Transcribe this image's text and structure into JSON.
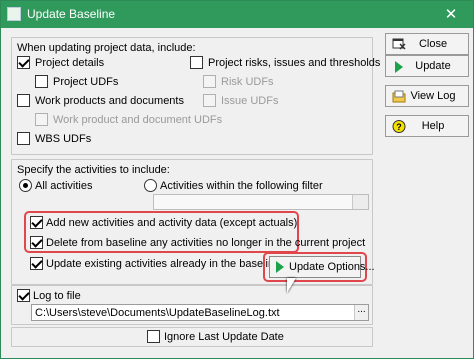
{
  "window": {
    "title": "Update Baseline",
    "close_glyph": "✕"
  },
  "section1": {
    "header": "When updating project data, include:",
    "project_details": {
      "label": "Project details",
      "checked": true
    },
    "project_udfs": {
      "label": "Project UDFs",
      "checked": false
    },
    "work_products": {
      "label": "Work products and documents",
      "checked": false
    },
    "work_product_udfs": {
      "label": "Work product and document UDFs",
      "checked": false,
      "disabled": true
    },
    "wbs_udfs": {
      "label": "WBS UDFs",
      "checked": false
    },
    "risks": {
      "label": "Project risks, issues and thresholds",
      "checked": false
    },
    "risk_udfs": {
      "label": "Risk UDFs",
      "checked": false,
      "disabled": true
    },
    "issue_udfs": {
      "label": "Issue UDFs",
      "checked": false,
      "disabled": true
    }
  },
  "section2": {
    "header": "Specify the activities to include:",
    "all_activities": {
      "label": "All activities",
      "selected": true
    },
    "filter_activities": {
      "label": "Activities within the following filter",
      "selected": false
    },
    "filter_value": "",
    "browse_glyph": "...",
    "add_new": {
      "label": "Add new activities and activity data (except actuals)",
      "checked": true
    },
    "delete_from_baseline": {
      "label": "Delete from baseline any activities no longer in the current project",
      "checked": true
    },
    "update_existing": {
      "label": "Update existing activities already in the baseline",
      "checked": true
    },
    "update_options_label": "Update Options..."
  },
  "section3": {
    "log_to_file": {
      "label": "Log to file",
      "checked": true
    },
    "log_path": "C:\\Users\\steve\\Documents\\UpdateBaselineLog.txt",
    "browse_glyph": "...",
    "ignore_last_update": {
      "label": "Ignore Last Update Date",
      "checked": false
    }
  },
  "side_buttons": {
    "close": {
      "label": "Close",
      "icon": "close-window-icon"
    },
    "update": {
      "label": "Update",
      "icon": "play-icon"
    },
    "view_log": {
      "label": "View Log",
      "icon": "folder-log-icon"
    },
    "help": {
      "label": "Help",
      "icon": "help-icon"
    }
  },
  "colors": {
    "titlebar": "#2f9a5c",
    "highlight": "#e0474c",
    "play": "#1aa34a"
  }
}
